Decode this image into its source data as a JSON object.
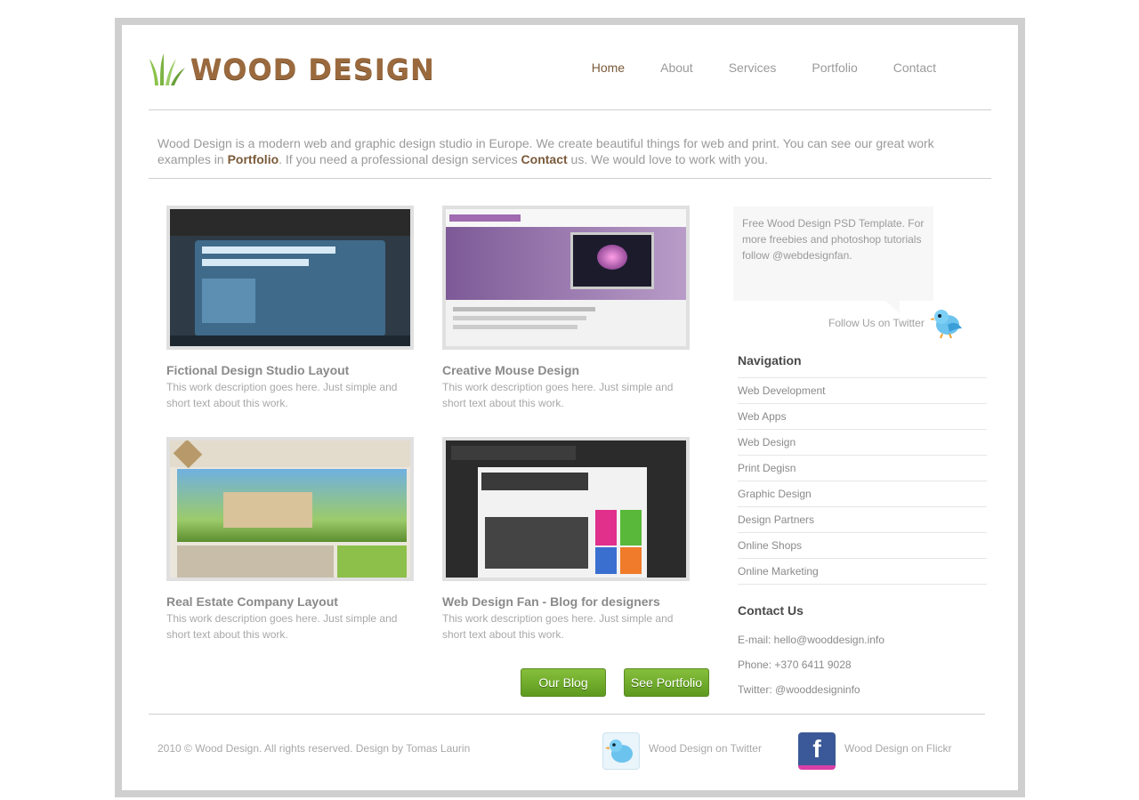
{
  "brand": {
    "name": "WOOD DESIGN"
  },
  "nav": {
    "items": [
      "Home",
      "About",
      "Services",
      "Portfolio",
      "Contact"
    ]
  },
  "intro": {
    "text_1": "Wood Design is a modern web and graphic design studio in Europe. We create beautiful things for web and print. You can see our great work examples in ",
    "link_portfolio": "Portfolio",
    "text_2": ". If you need a professional design services ",
    "link_contact": "Contact",
    "text_3": " us. We would love to work with you."
  },
  "portfolio": [
    {
      "title": "Fictional Design Studio Layout",
      "desc": "This work description goes here. Just simple and short text about this work."
    },
    {
      "title": "Creative Mouse Design",
      "desc": "This work description goes here. Just simple and short text about this work."
    },
    {
      "title": "Real Estate Company Layout",
      "desc": "This work description goes here. Just simple and short text about this work."
    },
    {
      "title": "Web Design Fan - Blog for designers",
      "desc": "This work description goes here. Just simple and short text about this work."
    }
  ],
  "buttons": {
    "blog": "Our Blog",
    "portfolio": "See Portfolio"
  },
  "twitter": {
    "text": "Free Wood Design PSD Template. For more freebies and photoshop tutorials follow @webdesignfan.",
    "follow": "Follow Us on Twitter"
  },
  "sidebar_nav": {
    "title": "Navigation",
    "items": [
      "Web Development",
      "Web Apps",
      "Web Design",
      "Print Degisn",
      "Graphic Design",
      "Design Partners",
      "Online Shops",
      "Online Marketing"
    ]
  },
  "contact": {
    "title": "Contact Us",
    "email": "E-mail: hello@wooddesign.info",
    "phone": "Phone: +370 6411 9028",
    "twitter": "Twitter: @wooddesigninfo"
  },
  "footer": {
    "copyright": "2010 © Wood Design. All rights reserved. Design by Tomas Laurin",
    "twitter_label": "Wood Design on Twitter",
    "flickr_label": "Wood Design on Flickr"
  },
  "colors": {
    "brand_brown": "#9a6a3e",
    "link_brown": "#7a5a3a",
    "button_green": "#6ca82a"
  }
}
